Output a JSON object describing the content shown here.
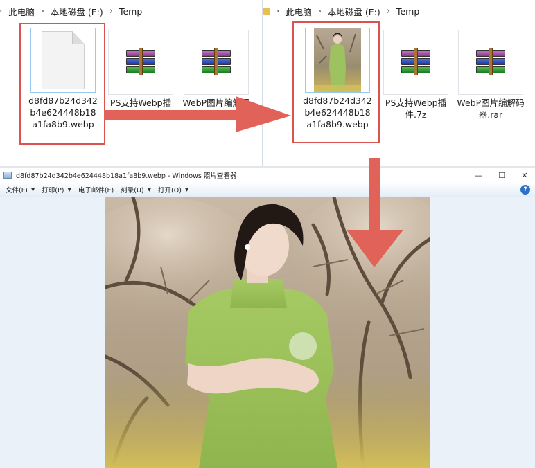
{
  "left_explorer": {
    "breadcrumb": [
      "此电脑",
      "本地磁盘 (E:)",
      "Temp"
    ],
    "files": [
      {
        "name": "d8fd87b24d342b4e624448b18a1fa8b9.webp",
        "icon": "blank-document-icon"
      },
      {
        "name": "PS支持Webp插件.7z",
        "icon": "winrar-archive-icon"
      },
      {
        "name": "WebP图片编解码器.rar",
        "icon": "winrar-archive-icon"
      }
    ]
  },
  "right_explorer": {
    "breadcrumb": [
      "此电脑",
      "本地磁盘 (E:)",
      "Temp"
    ],
    "files": [
      {
        "name": "d8fd87b24d342b4e624448b18a1fa8b9.webp",
        "icon": "photo-thumbnail-icon"
      },
      {
        "name": "PS支持Webp插件.7z",
        "icon": "winrar-archive-icon"
      },
      {
        "name": "WebP图片编解码器.rar",
        "icon": "winrar-archive-icon"
      }
    ]
  },
  "viewer": {
    "title": "d8fd87b24d342b4e624448b18a1fa8b9.webp - Windows 照片查看器",
    "menu": [
      "文件(F)",
      "打印(P)",
      "电子邮件(E)",
      "刻录(U)",
      "打开(O)"
    ],
    "controls": {
      "minimize": "—",
      "maximize": "☐",
      "close": "✕"
    },
    "help": "?"
  },
  "colors": {
    "highlight": "#d9544f",
    "arrow": "#e06258",
    "selection": "#cce8ff"
  }
}
